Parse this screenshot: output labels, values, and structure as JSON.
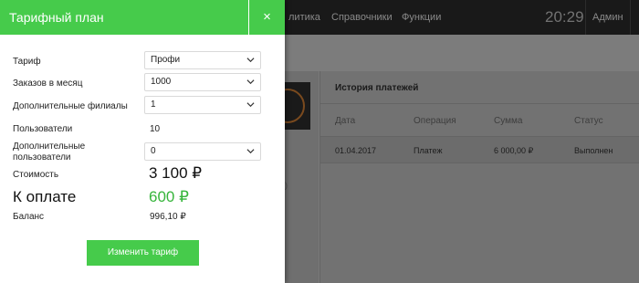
{
  "topbar": {
    "nav": [
      "литика",
      "Справочники",
      "Функции"
    ],
    "clock": "20:29",
    "user": "Админ"
  },
  "history": {
    "title": "История платежей",
    "columns": [
      "Дата",
      "Операция",
      "Сумма",
      "Статус"
    ],
    "rows": [
      {
        "date": "01.04.2017",
        "operation": "Платеж",
        "amount": "6 000,00 ₽",
        "status": "Выполнен"
      }
    ]
  },
  "modal": {
    "title": "Тарифный план",
    "close_label": "×",
    "fields": {
      "tariff": {
        "label": "Тариф",
        "value": "Профи"
      },
      "orders": {
        "label": "Заказов в месяц",
        "value": "1000"
      },
      "branches": {
        "label": "Дополнительные филиалы",
        "value": "1"
      },
      "users": {
        "label": "Пользователи",
        "value": "10"
      },
      "extra_users": {
        "label_line1": "Дополнительные",
        "label_line2": "пользователи",
        "value": "0"
      }
    },
    "cost": {
      "label": "Стоимость",
      "value": "3 100 ₽"
    },
    "to_pay": {
      "label": "К оплате",
      "value": "600 ₽"
    },
    "balance": {
      "label": "Баланс",
      "value": "996,10 ₽"
    },
    "submit_label": "Изменить тариф"
  },
  "background_fragments": {
    "stray_char": ")"
  },
  "colors": {
    "accent_green": "#46cb4b",
    "to_pay_green": "#37b53c",
    "topbar": "#191919",
    "ring_orange": "#7a4a1e"
  },
  "icons": {
    "close": "close-icon",
    "select_arrow": "chevron-down-icon"
  }
}
